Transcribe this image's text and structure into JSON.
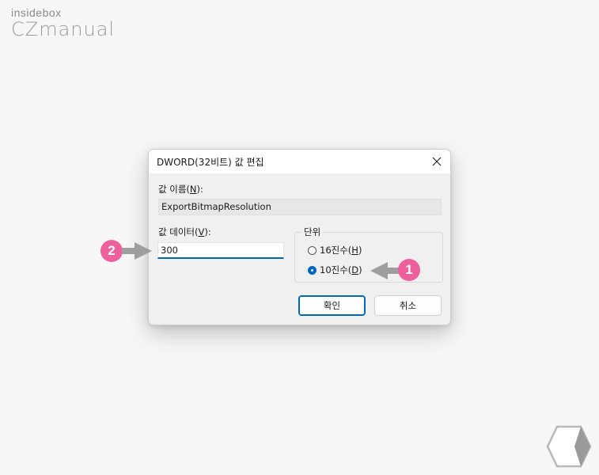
{
  "watermark": {
    "line1": "insidebox",
    "line2": "CZmanual"
  },
  "dialog": {
    "title": "DWORD(32비트) 값 편집",
    "value_name": {
      "label_prefix": "값 이름(",
      "label_key": "N",
      "label_suffix": "):",
      "value": "ExportBitmapResolution"
    },
    "value_data": {
      "label_prefix": "값 데이터(",
      "label_key": "V",
      "label_suffix": "):",
      "value": "300"
    },
    "base": {
      "title": "단위",
      "options": [
        {
          "prefix": "16진수(",
          "key": "H",
          "suffix": ")",
          "selected": false
        },
        {
          "prefix": "10진수(",
          "key": "D",
          "suffix": ")",
          "selected": true
        }
      ]
    },
    "buttons": {
      "ok": "확인",
      "cancel": "취소"
    }
  },
  "annotations": {
    "badge1": "1",
    "badge2": "2",
    "color": "#ef5f9c",
    "arrow_color": "#9e9e9e"
  }
}
